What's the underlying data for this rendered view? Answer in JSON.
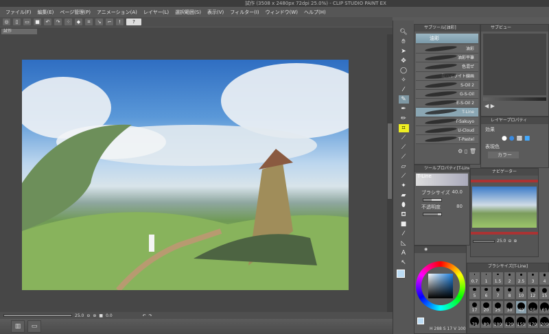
{
  "title": "試作 (3508 x 2480px 72dpi 25.0%) - CLIP STUDIO PAINT EX",
  "menu": [
    "ファイル(F)",
    "編集(E)",
    "ページ管理(P)",
    "アニメーション(A)",
    "レイヤー(L)",
    "選択範囲(S)",
    "表示(V)",
    "フィルター(I)",
    "ウィンドウ(W)",
    "ヘルプ(H)"
  ],
  "doc_tab": "試作",
  "status": {
    "zoom": "25.0",
    "angle": "0.0"
  },
  "subtool": {
    "title": "サブツール[油彩]",
    "group": "油彩",
    "brushes": [
      "油彩",
      "油彩平筆",
      "色混ぜ",
      "髪ハイライト線画",
      "S-Oil 2",
      "G-S-Oil",
      "E-S-Oil 2",
      "T-Line",
      "T-Sakuyo",
      "U-Cloud",
      "T-Pastel"
    ],
    "selected": "T-Line"
  },
  "subview": {
    "title": "サブビュー"
  },
  "layerprop": {
    "title": "レイヤープロパティ",
    "effect_label": "効果",
    "color_label": "表現色",
    "color_value": "カラー"
  },
  "toolprop": {
    "title": "ツールプロパティ[T-Line]",
    "preview_name": "T-Line",
    "brush_size_label": "ブラシサイズ",
    "brush_size": "40.0",
    "opacity_label": "不透明度",
    "opacity": "80",
    "brush_size_fill": 0.45,
    "opacity_fill": 0.8
  },
  "navigator": {
    "title": "ナビゲーター",
    "zoom": "25.0"
  },
  "color": {
    "main": "#bcdcf4",
    "sub": "#3a7fe0",
    "readout": [
      "288",
      "17",
      "100"
    ]
  },
  "brushsize": {
    "title": "ブラシサイズ[T-Line]",
    "sizes": [
      "0.7",
      "1",
      "1.5",
      "2",
      "2.5",
      "3",
      "4",
      "5",
      "6",
      "7",
      "8",
      "10",
      "12",
      "15",
      "17",
      "20",
      "25",
      "30",
      "40",
      "50",
      "60",
      "70",
      "80",
      "100",
      "120",
      "150",
      "170",
      "200"
    ],
    "selected": "40"
  }
}
